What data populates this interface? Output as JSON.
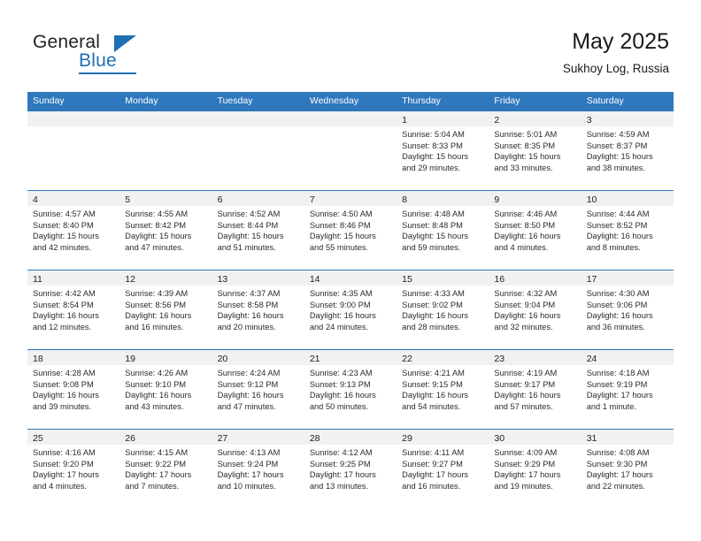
{
  "logo": {
    "word_one": "General",
    "word_two": "Blue",
    "triangle_icon": "blue-triangle-icon",
    "brand_color": "#1f6fb5"
  },
  "header": {
    "title": "May 2025",
    "subtitle": "Sukhoy Log, Russia"
  },
  "calendar": {
    "header_bg": "#2f78bd",
    "row_divider_color": "#2f78bd",
    "daynum_band_bg": "#f1f1f1",
    "weekdays": [
      "Sunday",
      "Monday",
      "Tuesday",
      "Wednesday",
      "Thursday",
      "Friday",
      "Saturday"
    ],
    "weeks": [
      [
        {
          "day": "",
          "lines": []
        },
        {
          "day": "",
          "lines": []
        },
        {
          "day": "",
          "lines": []
        },
        {
          "day": "",
          "lines": []
        },
        {
          "day": "1",
          "lines": [
            "Sunrise: 5:04 AM",
            "Sunset: 8:33 PM",
            "Daylight: 15 hours",
            "and 29 minutes."
          ]
        },
        {
          "day": "2",
          "lines": [
            "Sunrise: 5:01 AM",
            "Sunset: 8:35 PM",
            "Daylight: 15 hours",
            "and 33 minutes."
          ]
        },
        {
          "day": "3",
          "lines": [
            "Sunrise: 4:59 AM",
            "Sunset: 8:37 PM",
            "Daylight: 15 hours",
            "and 38 minutes."
          ]
        }
      ],
      [
        {
          "day": "4",
          "lines": [
            "Sunrise: 4:57 AM",
            "Sunset: 8:40 PM",
            "Daylight: 15 hours",
            "and 42 minutes."
          ]
        },
        {
          "day": "5",
          "lines": [
            "Sunrise: 4:55 AM",
            "Sunset: 8:42 PM",
            "Daylight: 15 hours",
            "and 47 minutes."
          ]
        },
        {
          "day": "6",
          "lines": [
            "Sunrise: 4:52 AM",
            "Sunset: 8:44 PM",
            "Daylight: 15 hours",
            "and 51 minutes."
          ]
        },
        {
          "day": "7",
          "lines": [
            "Sunrise: 4:50 AM",
            "Sunset: 8:46 PM",
            "Daylight: 15 hours",
            "and 55 minutes."
          ]
        },
        {
          "day": "8",
          "lines": [
            "Sunrise: 4:48 AM",
            "Sunset: 8:48 PM",
            "Daylight: 15 hours",
            "and 59 minutes."
          ]
        },
        {
          "day": "9",
          "lines": [
            "Sunrise: 4:46 AM",
            "Sunset: 8:50 PM",
            "Daylight: 16 hours",
            "and 4 minutes."
          ]
        },
        {
          "day": "10",
          "lines": [
            "Sunrise: 4:44 AM",
            "Sunset: 8:52 PM",
            "Daylight: 16 hours",
            "and 8 minutes."
          ]
        }
      ],
      [
        {
          "day": "11",
          "lines": [
            "Sunrise: 4:42 AM",
            "Sunset: 8:54 PM",
            "Daylight: 16 hours",
            "and 12 minutes."
          ]
        },
        {
          "day": "12",
          "lines": [
            "Sunrise: 4:39 AM",
            "Sunset: 8:56 PM",
            "Daylight: 16 hours",
            "and 16 minutes."
          ]
        },
        {
          "day": "13",
          "lines": [
            "Sunrise: 4:37 AM",
            "Sunset: 8:58 PM",
            "Daylight: 16 hours",
            "and 20 minutes."
          ]
        },
        {
          "day": "14",
          "lines": [
            "Sunrise: 4:35 AM",
            "Sunset: 9:00 PM",
            "Daylight: 16 hours",
            "and 24 minutes."
          ]
        },
        {
          "day": "15",
          "lines": [
            "Sunrise: 4:33 AM",
            "Sunset: 9:02 PM",
            "Daylight: 16 hours",
            "and 28 minutes."
          ]
        },
        {
          "day": "16",
          "lines": [
            "Sunrise: 4:32 AM",
            "Sunset: 9:04 PM",
            "Daylight: 16 hours",
            "and 32 minutes."
          ]
        },
        {
          "day": "17",
          "lines": [
            "Sunrise: 4:30 AM",
            "Sunset: 9:06 PM",
            "Daylight: 16 hours",
            "and 36 minutes."
          ]
        }
      ],
      [
        {
          "day": "18",
          "lines": [
            "Sunrise: 4:28 AM",
            "Sunset: 9:08 PM",
            "Daylight: 16 hours",
            "and 39 minutes."
          ]
        },
        {
          "day": "19",
          "lines": [
            "Sunrise: 4:26 AM",
            "Sunset: 9:10 PM",
            "Daylight: 16 hours",
            "and 43 minutes."
          ]
        },
        {
          "day": "20",
          "lines": [
            "Sunrise: 4:24 AM",
            "Sunset: 9:12 PM",
            "Daylight: 16 hours",
            "and 47 minutes."
          ]
        },
        {
          "day": "21",
          "lines": [
            "Sunrise: 4:23 AM",
            "Sunset: 9:13 PM",
            "Daylight: 16 hours",
            "and 50 minutes."
          ]
        },
        {
          "day": "22",
          "lines": [
            "Sunrise: 4:21 AM",
            "Sunset: 9:15 PM",
            "Daylight: 16 hours",
            "and 54 minutes."
          ]
        },
        {
          "day": "23",
          "lines": [
            "Sunrise: 4:19 AM",
            "Sunset: 9:17 PM",
            "Daylight: 16 hours",
            "and 57 minutes."
          ]
        },
        {
          "day": "24",
          "lines": [
            "Sunrise: 4:18 AM",
            "Sunset: 9:19 PM",
            "Daylight: 17 hours",
            "and 1 minute."
          ]
        }
      ],
      [
        {
          "day": "25",
          "lines": [
            "Sunrise: 4:16 AM",
            "Sunset: 9:20 PM",
            "Daylight: 17 hours",
            "and 4 minutes."
          ]
        },
        {
          "day": "26",
          "lines": [
            "Sunrise: 4:15 AM",
            "Sunset: 9:22 PM",
            "Daylight: 17 hours",
            "and 7 minutes."
          ]
        },
        {
          "day": "27",
          "lines": [
            "Sunrise: 4:13 AM",
            "Sunset: 9:24 PM",
            "Daylight: 17 hours",
            "and 10 minutes."
          ]
        },
        {
          "day": "28",
          "lines": [
            "Sunrise: 4:12 AM",
            "Sunset: 9:25 PM",
            "Daylight: 17 hours",
            "and 13 minutes."
          ]
        },
        {
          "day": "29",
          "lines": [
            "Sunrise: 4:11 AM",
            "Sunset: 9:27 PM",
            "Daylight: 17 hours",
            "and 16 minutes."
          ]
        },
        {
          "day": "30",
          "lines": [
            "Sunrise: 4:09 AM",
            "Sunset: 9:29 PM",
            "Daylight: 17 hours",
            "and 19 minutes."
          ]
        },
        {
          "day": "31",
          "lines": [
            "Sunrise: 4:08 AM",
            "Sunset: 9:30 PM",
            "Daylight: 17 hours",
            "and 22 minutes."
          ]
        }
      ]
    ]
  }
}
